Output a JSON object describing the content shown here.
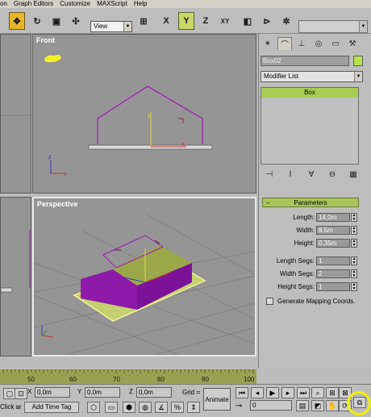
{
  "menubar": {
    "items": [
      "on",
      "Graph Editors",
      "Customize",
      "MAXScript",
      "Help"
    ]
  },
  "toolbar": {
    "view_dropdown": "View",
    "selection_set": ""
  },
  "viewports": {
    "front_label": "Front",
    "perspective_label": "Perspective"
  },
  "command_panel": {
    "object_name": "Box02",
    "object_color": "#b6e24a",
    "modifier_list": "Modifier List",
    "stack_items": [
      "Box"
    ],
    "parameters": {
      "header": "Parameters",
      "length_label": "Length:",
      "length_value": "14,0m",
      "width_label": "Width:",
      "width_value": "8,5m",
      "height_label": "Height:",
      "height_value": "0,35m",
      "length_segs_label": "Length Segs:",
      "length_segs_value": "1",
      "width_segs_label": "Width Segs:",
      "width_segs_value": "2",
      "height_segs_label": "Height Segs:",
      "height_segs_value": "1",
      "gen_mapping_label": "Generate Mapping Coords."
    }
  },
  "timeline": {
    "ticks": [
      "50",
      "60",
      "70",
      "80",
      "90",
      "100"
    ]
  },
  "status": {
    "x_label": "X",
    "x_value": "0,0m",
    "y_label": "Y",
    "y_value": "0,0m",
    "z_label": "Z",
    "z_value": "0,0m",
    "grid_label": "Grid =",
    "animate_label": "Animate",
    "frame_value": "0",
    "click_hint": "Click ar",
    "add_time_tag": "Add Time Tag"
  },
  "colors": {
    "accent_active": "#e8b429",
    "object_purple": "#8d1aa8",
    "ground_olive": "#8e9c3c",
    "highlight": "#f0f000"
  }
}
